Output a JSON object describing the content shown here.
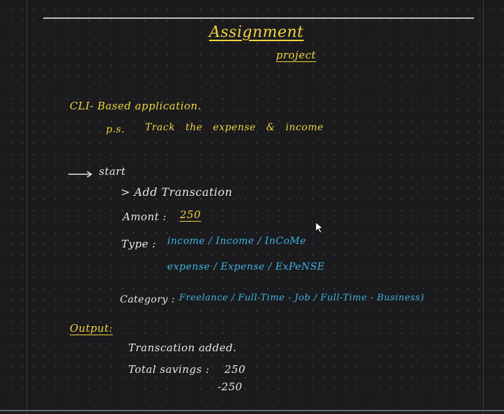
{
  "title": "Assignment",
  "subtitle": "project",
  "heading": "CLI- Based application.",
  "ps_label": "p.s.",
  "ps_text": "Track the expense & income",
  "start": "start",
  "add_transaction": "> Add Transcation",
  "amount_label": "Amont :",
  "amount_value": "250",
  "type_label": "Type :",
  "type_income": "income / Income / InCoMe",
  "type_expense": "expense / Expense / ExPeNSE",
  "category_label": "Category :",
  "category_values": "Freelance / Full-Time - Job / Full-Time - Business)",
  "output_label": "Output:",
  "output_line1": "Transcation added.",
  "total_label": "Total savings :",
  "total_value1": "250",
  "total_value2": "-250",
  "colors": {
    "accent_yellow": "#f2d43f",
    "accent_blue": "#3fb3e6",
    "text_white": "#e8e8e8"
  }
}
